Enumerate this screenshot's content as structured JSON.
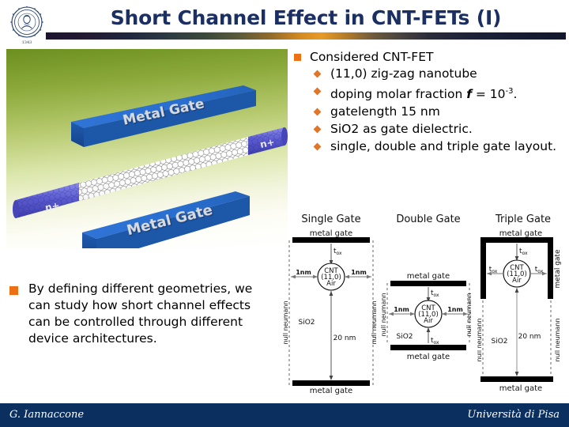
{
  "slide": {
    "title": "Short Channel Effect in CNT-FETs (I)",
    "logo_alt": "university-of-pisa-seal"
  },
  "bullets": {
    "heading": "Considered CNT-FET",
    "items": [
      {
        "text": "(11,0) zig-zag nanotube"
      },
      {
        "pre": "doping molar fraction ",
        "ital": "f",
        "mid": " = 10",
        "sup": "-3",
        "post": "."
      },
      {
        "text": "gatelength 15 nm"
      },
      {
        "text": "SiO2 as gate dielectric."
      },
      {
        "text": "single, double and triple gate layout."
      }
    ]
  },
  "paragraph": {
    "text": " By defining different geometries, we can study how short channel effects can be controlled through different device architectures."
  },
  "render": {
    "gate_top_label": "Metal Gate",
    "gate_bottom_label": "Metal Gate",
    "contact_left_label": "n+",
    "contact_right_label": "n+"
  },
  "diagrams": [
    {
      "id": "single-gate",
      "title": "Single Gate",
      "top_gate": "metal gate",
      "bottom_gate": "metal gate",
      "tox_top": "t",
      "tox_sub": "ox",
      "left_gap": "1nm",
      "right_gap": "1nm",
      "cnt_l1": "CNT",
      "cnt_l2": "(11,0)",
      "cnt_l3": "Air",
      "dielectric": "SiO2",
      "height_label": "20 nm",
      "bc_left": "null neumann",
      "bc_right": "null neumann"
    },
    {
      "id": "double-gate",
      "title": "Double Gate",
      "top_gate": "metal gate",
      "bottom_gate": "metal gate",
      "tox_top": "t",
      "tox_sub": "ox",
      "tox_bottom": "t",
      "left_gap": "1nm",
      "right_gap": "1nm",
      "cnt_l1": "CNT",
      "cnt_l2": "(11,0)",
      "cnt_l3": "Air",
      "dielectric": "SiO2",
      "bc_left": "null neumann",
      "bc_right": "null neumann"
    },
    {
      "id": "triple-gate",
      "title": "Triple Gate",
      "top_gate": "metal gate",
      "bottom_gate": "metal gate",
      "side_gate_left": "metal gate",
      "side_gate_right": "metal gate",
      "tox_top": "t",
      "tox_sub": "ox",
      "tox_left": "t",
      "tox_right": "t",
      "cnt_l1": "CNT",
      "cnt_l2": "(11,0)",
      "cnt_l3": "Air",
      "dielectric": "SiO2",
      "height_label": "20 nm",
      "bc_left": "null neumann",
      "bc_right": "null neumann"
    }
  ],
  "footer": {
    "left": "G. Iannaccone",
    "right": "Università di  Pisa"
  },
  "colors": {
    "title": "#1b2f63",
    "bullet_square": "#ee7014",
    "bullet_diamond": "#e0762a",
    "footer_bg": "#0b2f5e",
    "gate_blue": "#2a6fd0",
    "doped_purple": "#5b5bd0"
  }
}
